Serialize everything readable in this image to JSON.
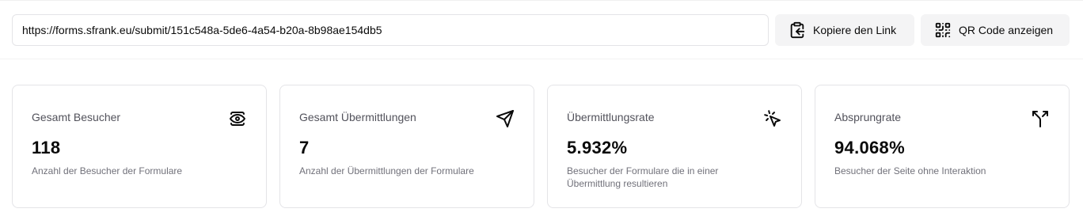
{
  "share": {
    "url": "https://forms.sfrank.eu/submit/151c548a-5de6-4a54-b20a-8b98ae154db5",
    "copy_label": "Kopiere den Link",
    "qr_label": "QR Code anzeigen"
  },
  "stats": [
    {
      "title": "Gesamt Besucher",
      "value": "118",
      "description": "Anzahl der Besucher der Formulare",
      "icon": "eye-icon"
    },
    {
      "title": "Gesamt Übermittlungen",
      "value": "7",
      "description": "Anzahl der Übermittlungen der Formulare",
      "icon": "send-icon"
    },
    {
      "title": "Übermittlungsrate",
      "value": "5.932%",
      "description": "Besucher der Formulare die in einer Übermittlung resultieren",
      "icon": "mouse-pointer-click-icon"
    },
    {
      "title": "Absprungrate",
      "value": "94.068%",
      "description": "Besucher der Seite ohne Interaktion",
      "icon": "split-icon"
    }
  ]
}
